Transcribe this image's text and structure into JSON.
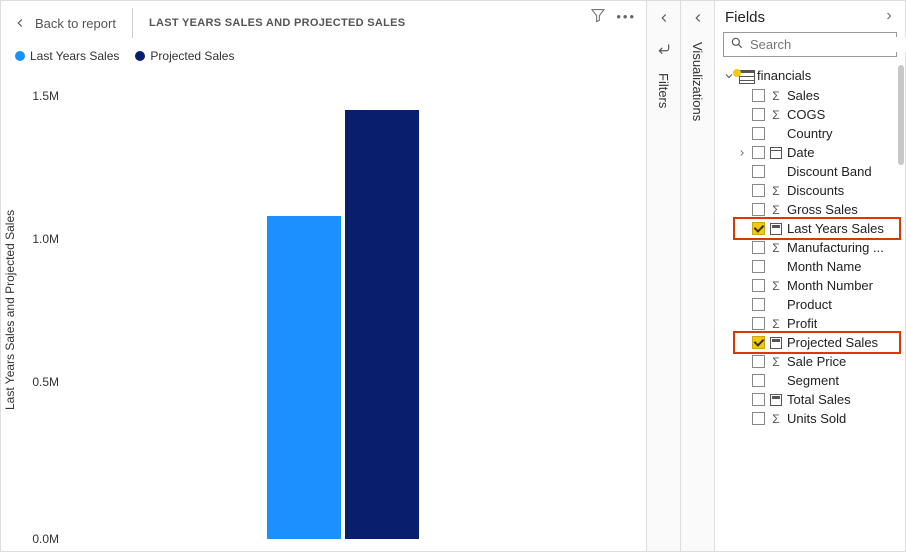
{
  "header": {
    "back_label": "Back to report",
    "title": "LAST YEARS SALES AND PROJECTED SALES"
  },
  "legend": [
    {
      "color": "#1a91ff",
      "label": "Last Years Sales"
    },
    {
      "color": "#0a1e6e",
      "label": "Projected Sales"
    }
  ],
  "ylabel": "Last Years Sales and Projected Sales",
  "y_ticks": [
    "0.0M",
    "0.5M",
    "1.0M",
    "1.5M"
  ],
  "panels": {
    "filters": "Filters",
    "visualizations": "Visualizations"
  },
  "fields_pane": {
    "title": "Fields",
    "search_placeholder": "Search",
    "table": "financials",
    "items": [
      {
        "label": "Sales",
        "icon": "sigma",
        "checked": false
      },
      {
        "label": "COGS",
        "icon": "sigma",
        "checked": false
      },
      {
        "label": "Country",
        "icon": "",
        "checked": false
      },
      {
        "label": "Date",
        "icon": "calendar",
        "checked": false,
        "expandable": true
      },
      {
        "label": "Discount Band",
        "icon": "",
        "checked": false
      },
      {
        "label": "Discounts",
        "icon": "sigma",
        "checked": false
      },
      {
        "label": "Gross Sales",
        "icon": "sigma",
        "checked": false
      },
      {
        "label": "Last Years Sales",
        "icon": "calc",
        "checked": true,
        "highlight": true
      },
      {
        "label": "Manufacturing ...",
        "icon": "sigma",
        "checked": false
      },
      {
        "label": "Month Name",
        "icon": "",
        "checked": false
      },
      {
        "label": "Month Number",
        "icon": "sigma",
        "checked": false
      },
      {
        "label": "Product",
        "icon": "",
        "checked": false
      },
      {
        "label": "Profit",
        "icon": "sigma",
        "checked": false
      },
      {
        "label": "Projected Sales",
        "icon": "calc",
        "checked": true,
        "highlight": true
      },
      {
        "label": "Sale Price",
        "icon": "sigma",
        "checked": false
      },
      {
        "label": "Segment",
        "icon": "",
        "checked": false
      },
      {
        "label": "Total Sales",
        "icon": "calc",
        "checked": false
      },
      {
        "label": "Units Sold",
        "icon": "sigma",
        "checked": false
      }
    ]
  },
  "chart_data": {
    "type": "bar",
    "categories": [
      ""
    ],
    "series": [
      {
        "name": "Last Years Sales",
        "color": "#1a91ff",
        "values": [
          1130000
        ]
      },
      {
        "name": "Projected Sales",
        "color": "#0a1e6e",
        "values": [
          1500000
        ]
      }
    ],
    "ylabel": "Last Years Sales and Projected Sales",
    "ylim": [
      0,
      1600000
    ],
    "y_ticks": [
      0,
      500000,
      1000000,
      1500000
    ],
    "title": "LAST YEARS SALES AND PROJECTED SALES"
  }
}
